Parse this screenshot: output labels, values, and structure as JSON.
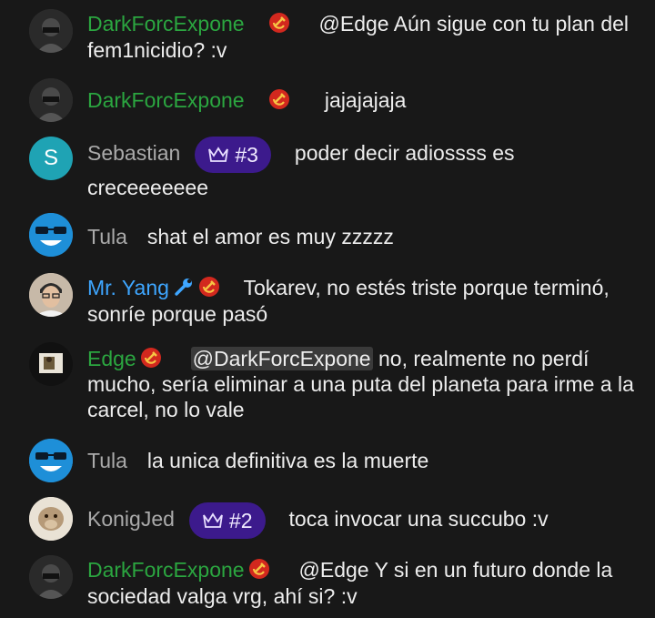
{
  "messages": [
    {
      "author": "DarkForcExpone",
      "text": "@Edge Aún sigue con tu plan del fem1nicidio? :v"
    },
    {
      "author": "DarkForcExpone",
      "text": "jajajajaja"
    },
    {
      "author": "Sebastian",
      "avatar_letter": "S",
      "rank": "#3",
      "text": "poder decir adiossss es creceeeeeee"
    },
    {
      "author": "Tula",
      "text": "shat el amor es muy zzzzz"
    },
    {
      "author": "Mr. Yang",
      "text": "Tokarev, no estés triste porque terminó, sonríe porque pasó"
    },
    {
      "author": "Edge",
      "mention": "@DarkForcExpone",
      "text": "no, realmente no perdí mucho, sería eliminar a una puta del planeta para irme a la carcel, no lo vale"
    },
    {
      "author": "Tula",
      "text": "la unica definitiva es la muerte"
    },
    {
      "author": "KonigJed",
      "rank": "#2",
      "text": "toca invocar una succubo :v"
    },
    {
      "author": "DarkForcExpone",
      "text": "@Edge Y si en un futuro donde la sociedad valga vrg, ahí si? :v"
    }
  ],
  "colors": {
    "background": "#181818",
    "member_name": "#2ba640",
    "moderator_name": "#3ea6ff",
    "rank_badge": "#3c1a8c"
  },
  "icons": [
    "hammer-sickle-icon",
    "wrench-icon",
    "crown-icon"
  ]
}
